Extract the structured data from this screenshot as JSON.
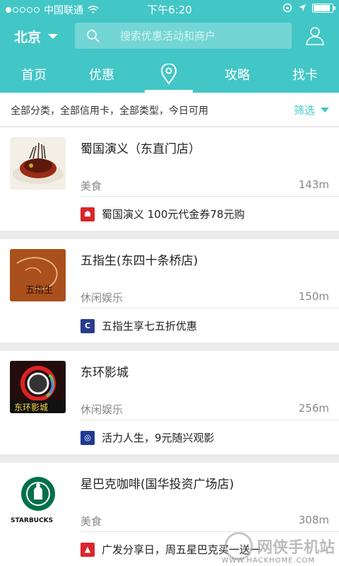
{
  "status_bar": {
    "carrier": "中国联通",
    "time": "下午6:20",
    "battery_level": 0.9
  },
  "header": {
    "city": "北京",
    "search_placeholder": "搜索优惠活动和商户",
    "tabs": [
      {
        "label": "首页",
        "active": false
      },
      {
        "label": "优惠",
        "active": false
      },
      {
        "label": "",
        "icon": "location-pin-icon",
        "active": true
      },
      {
        "label": "攻略",
        "active": false
      },
      {
        "label": "找卡",
        "active": false
      }
    ]
  },
  "filter": {
    "description": "全部分类，全部信用卡，全部类型，今日可用",
    "button_label": "筛选"
  },
  "merchants": [
    {
      "name": "蜀国演义（东直门店）",
      "category": "美食",
      "distance": "143m",
      "offer": "蜀国演义 100元代金券78元购",
      "bank_icon": "bank-of-beijing-icon",
      "bank_color": "#d8272d",
      "bank_glyph": "☗"
    },
    {
      "name": "五指生(东四十条桥店)",
      "category": "休闲娱乐",
      "distance": "150m",
      "offer": "五指生享七五折优惠",
      "bank_icon": "cmbc-icon",
      "bank_color": "#2a3b8f",
      "bank_glyph": "C"
    },
    {
      "name": "东环影城",
      "category": "休闲娱乐",
      "distance": "256m",
      "offer": "活力人生，9元随兴观影",
      "bank_icon": "bank-card-icon",
      "bank_color": "#1f3a93",
      "bank_glyph": "◎"
    },
    {
      "name": "星巴克咖啡(国华投资广场店)",
      "category": "美食",
      "distance": "308m",
      "offer": "广发分享日，周五星巴克买一送一",
      "bank_icon": "cgb-icon",
      "bank_color": "#d8272d",
      "bank_glyph": "▲"
    }
  ],
  "thumb_text": {
    "wuzhisheng": "五指生",
    "donghuan": "东环影城",
    "starbucks": "STARBUCKS"
  },
  "watermark": {
    "brand": "网侠手机站",
    "url": "WWW.HACKHOME.COM"
  },
  "colors": {
    "accent": "#43c6c6",
    "background": "#ebebeb"
  }
}
